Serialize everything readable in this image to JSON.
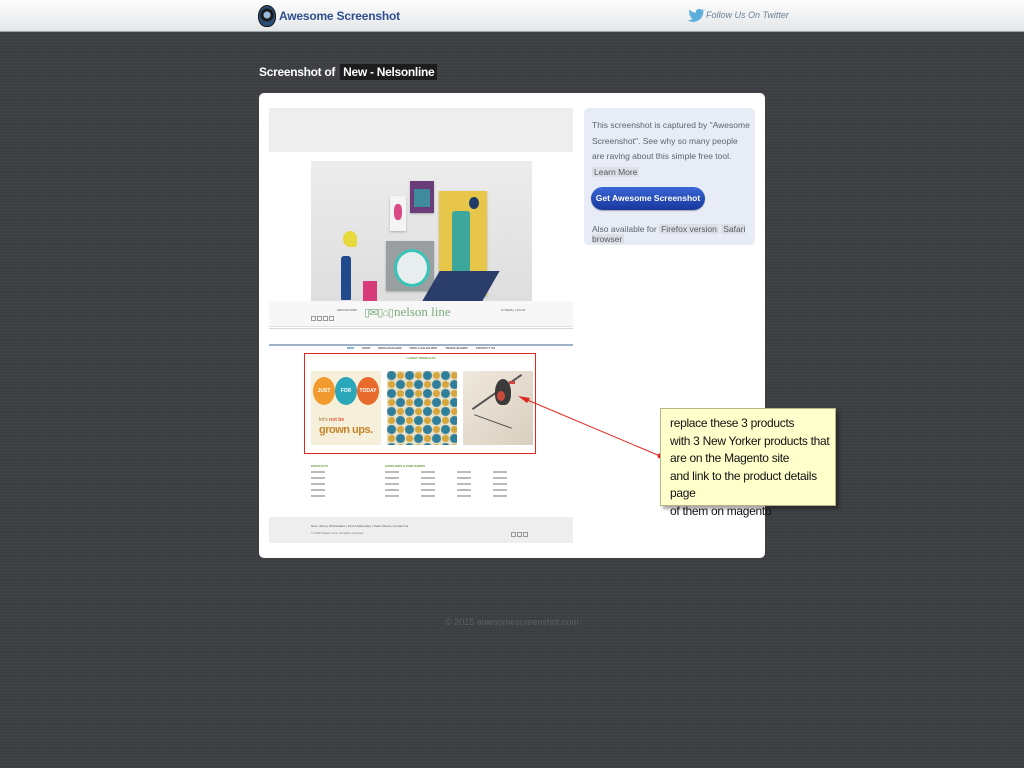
{
  "header": {
    "app_name": "Awesome Screenshot",
    "twitter_link": "Follow Us On Twitter",
    "logo_icon": "camera-lens-icon",
    "twitter_icon": "twitter-bird-icon"
  },
  "page": {
    "title_prefix": "Screenshot of",
    "site_name": "New - Nelsonline"
  },
  "screenshot": {
    "site_logo": "nelson line",
    "phone": "1800 000 9945",
    "cart": "0 ITEMS  |  LOG IN",
    "nav": [
      "NEW",
      "SHOP",
      "WHOLESALERS",
      "FIND A SALES REP",
      "TRADE SHOWS",
      "CONTACT US"
    ],
    "latest_label": "LATEST PRODUCTS",
    "products": {
      "p1_balloons": [
        "JUST",
        "FOR",
        "TODAY"
      ],
      "p1_line1_a": "let's",
      "p1_line1_b": "not be",
      "p1_line2": "grown ups."
    },
    "footer_headings": [
      "PRODUCTS",
      "SUPPLIERS & PUBLISHERS"
    ],
    "bottom_links": "New  |  Shop  |  Wholesalers  |  Find A Sales Rep  |  Trade Shows  |  Contact Us",
    "bottom_copy": "© 2015 Nelson Line. All rights reserved."
  },
  "info": {
    "description": "This screenshot is captured by \"Awesome Screenshot\". See why so many people are raving about this simple free tool.",
    "learn_more": "Learn More",
    "get_button": "Get Awesome Screenshot",
    "also_label": "Also available for",
    "firefox": "Firefox version",
    "safari": "Safari browser"
  },
  "annotation": {
    "text": "replace these 3 products\nwith 3 New Yorker products that\nare on the Magento site\nand link to the product details page\nof them on magento",
    "color": "#e0261c"
  },
  "footer": {
    "copyright": "© 2015 awesomescreenshot.com"
  }
}
